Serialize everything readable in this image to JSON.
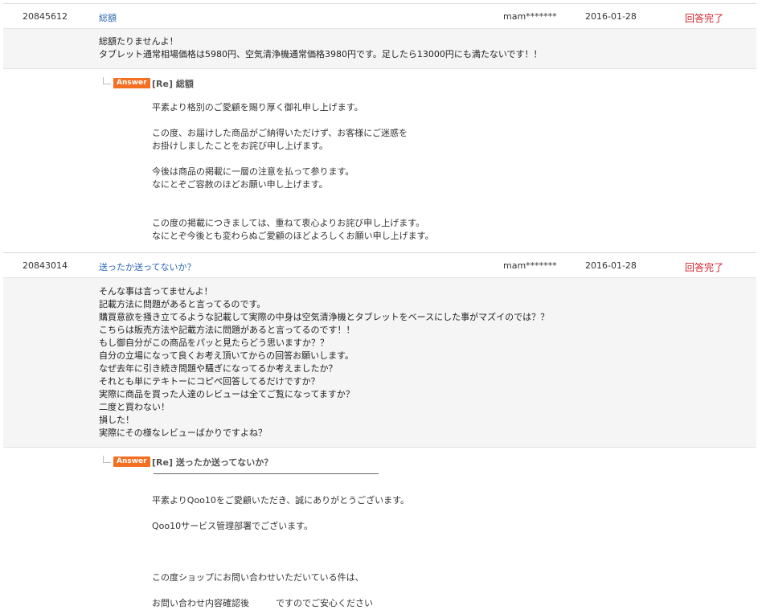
{
  "qa_list": [
    {
      "id": "20845612",
      "title": "総額",
      "user": "mam*******",
      "date": "2016-01-28",
      "status": "回答完了",
      "question": "総額たりませんよ！\nタブレット通常相場価格は5980円、空気清浄機通常価格3980円です。足したら13000円にも満たないです！！",
      "answer_badge": "Answer",
      "answer_title": "[Re] 総額",
      "answer_body": "平素より格別のご愛顧を賜り厚く御礼申し上げます。\n\nこの度、お届けした商品がご納得いただけず、お客様にご迷惑を\nお掛けしましたことをお詫び申し上げます。\n\n今後は商品の掲載に一層の注意を払って参ります。\nなにとぞご容赦のほどお願い申し上げます。\n\n\nこの度の掲載につきましては、重ねて衷心よりお詫び申し上げます。\nなにとぞ今後とも変わらぬご愛顧のほどよろしくお願い申し上げます。"
    },
    {
      "id": "20843014",
      "title": "送ったか送ってないか？",
      "user": "mam*******",
      "date": "2016-01-28",
      "status": "回答完了",
      "question": "そんな事は言ってませんよ！\n記載方法に問題があると言ってるのです。\n購買意欲を掻き立てるような記載して実際の中身は空気清浄機とタブレットをベースにした事がマズイのでは？？\nこちらは販売方法や記載方法に問題があると言ってるのです！！\nもし御自分がこの商品をパッと見たらどう思いますか？？\n自分の立場になって良くお考え頂いてからの回答お願いします。\nなぜ去年に引き続き問題や騒ぎになってるか考えましたか？\nそれとも単にテキトーにコピペ回答してるだけですか？\n実際に商品を買った人達のレビューは全てご覧になってますか？\n二度と買わない！\n損した！\n実際にその様なレビューばかりですよね？",
      "answer_badge": "Answer",
      "answer_title": "[Re] 送ったか送ってないか？",
      "answer_body": "平素よりQoo10をご愛顧いただき、誠にありがとうございます。\n\nQoo10サービス管理部署でございます。\n\n\n\nこの度ショップにお問い合わせいただいている件は、\n\nお問い合わせ内容確認後　　　ですのでご安心ください"
    }
  ]
}
